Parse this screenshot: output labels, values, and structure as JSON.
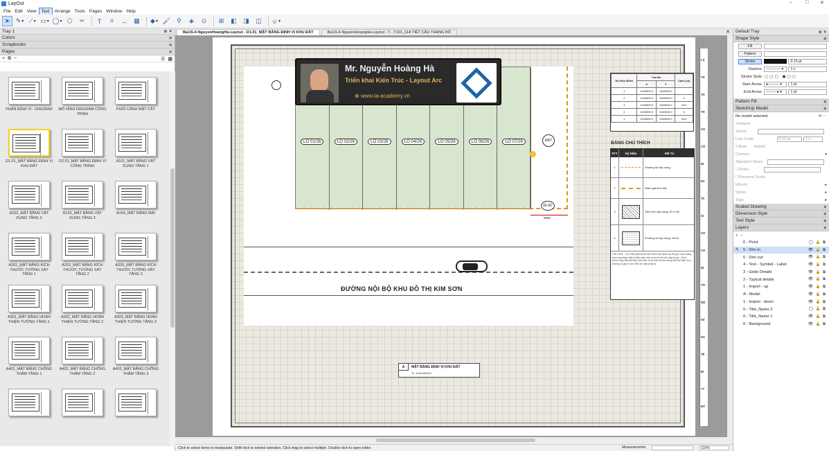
{
  "window": {
    "title": "LayOut",
    "controls": [
      "–",
      "□",
      "✕"
    ]
  },
  "menu": [
    "File",
    "Edit",
    "View",
    "Text",
    "Arrange",
    "Tools",
    "Pages",
    "Window",
    "Help"
  ],
  "menu_active": "Text",
  "toolbar": [
    {
      "icon": "select-icon",
      "glyph": "➤"
    },
    {
      "icon": "pencil-icon",
      "glyph": "✎"
    },
    {
      "icon": "line-icon",
      "glyph": "⟋"
    },
    {
      "icon": "rectangle-icon",
      "glyph": "▭"
    },
    {
      "icon": "circle-icon",
      "glyph": "◯"
    },
    {
      "icon": "polygon-icon",
      "glyph": "⬠"
    },
    {
      "icon": "split-icon",
      "glyph": "✂"
    },
    {
      "icon": "text-icon",
      "glyph": "T"
    },
    {
      "icon": "label-icon",
      "glyph": "⌗"
    },
    {
      "icon": "dimension-icon",
      "glyph": "↔"
    },
    {
      "icon": "table-icon",
      "glyph": "▦"
    },
    {
      "icon": "eraser-icon",
      "glyph": "◆"
    },
    {
      "icon": "style-icon",
      "glyph": "🖌"
    },
    {
      "icon": "sample-icon",
      "glyph": "⚲"
    },
    {
      "icon": "fill-icon",
      "glyph": "◈"
    },
    {
      "icon": "view-icon",
      "glyph": "⊙"
    },
    {
      "icon": "add-page-icon",
      "glyph": "⊞"
    },
    {
      "icon": "prev-page-icon",
      "glyph": "◧"
    },
    {
      "icon": "next-page-icon",
      "glyph": "◨"
    },
    {
      "icon": "presentation-icon",
      "glyph": "◫"
    },
    {
      "icon": "account-icon",
      "glyph": "☺"
    }
  ],
  "tray_left": {
    "title": "Tray 1",
    "sections": [
      "Colors",
      "Scrapbooks",
      "Pages"
    ]
  },
  "pages": [
    {
      "label": "PHÂN ĐỊNH VI - DIAGRAM",
      "selected": false
    },
    {
      "label": "MÔ HÌNH DIAGRAM CÔNG TRÌNH",
      "selected": false
    },
    {
      "label": "PHỐI CẢNH MẶT CẮT",
      "selected": false
    },
    {
      "label": "D1.01_MẶT BẰNG ĐỊNH VỊ KHU ĐẤT",
      "selected": true
    },
    {
      "label": "D2.01_MẶT BẰNG ĐỊNH VỊ CÔNG TRÌNH",
      "selected": false
    },
    {
      "label": "A101_MẶT BẰNG VẬT DỤNG TẦNG 1",
      "selected": false
    },
    {
      "label": "A102_MẶT BẰNG VẬT DỤNG TẦNG 2",
      "selected": false
    },
    {
      "label": "A103_MẶT BẰNG VẬT DỤNG TẦNG 3",
      "selected": false
    },
    {
      "label": "A104_MẶT BẰNG MÁI",
      "selected": false
    },
    {
      "label": "A201_MẶT BẰNG KÍCH THƯỚC TƯỜNG XÂY TẦNG 1",
      "selected": false
    },
    {
      "label": "A202_MẶT BẰNG KÍCH THƯỚC TƯỜNG XÂY TẦNG 2",
      "selected": false
    },
    {
      "label": "A203_MẶT BẰNG KÍCH THƯỚC TƯỜNG XÂY TẦNG 3",
      "selected": false
    },
    {
      "label": "A301_MẶT BẰNG HOÀN THIỆN TƯỜNG TẦNG 1",
      "selected": false
    },
    {
      "label": "A302_MẶT BẰNG HOÀN THIỆN TƯỜNG TẦNG 2",
      "selected": false
    },
    {
      "label": "A303_MẶT BẰNG HOÀN THIỆN TƯỜNG TẦNG 3",
      "selected": false
    },
    {
      "label": "A401_MẶT BẰNG CHỐNG THẤM TẦNG 1",
      "selected": false
    },
    {
      "label": "A402_MẶT BẰNG CHỐNG THẤM TẦNG 2",
      "selected": false
    },
    {
      "label": "A403_MẶT BẰNG CHỐNG THẤM TẦNG 3",
      "selected": false
    },
    {
      "label": "",
      "selected": false
    },
    {
      "label": "",
      "selected": false
    },
    {
      "label": "",
      "selected": false
    }
  ],
  "tabs": [
    {
      "label": "Bai15.4-NguyenHoangHa-Layout - D1.01_MẶT BẰNG ĐỊNH VỊ KHU ĐẤT",
      "active": true
    },
    {
      "label": "Bai15.4-NguyenHoangHa-Layout - T - T101_CHI TIẾT CẦU THANG BỘ",
      "active": false
    }
  ],
  "drawing": {
    "lots": [
      "LÔ 01/26",
      "LÔ 02/26",
      "LÔ 03/26",
      "LÔ 04/26",
      "LÔ 05/26",
      "LÔ 06/26",
      "LÔ 07/26"
    ],
    "road_label": "ĐƯỜNG NỘI BỘ KHU ĐÔ THỊ KIM SƠN",
    "markers": [
      "ĐĐT",
      "ĐLXD"
    ],
    "dim_bottom": "5000",
    "banner": {
      "name": "Mr. Nguyễn Hoàng Hà",
      "role": "Triển khai Kiến Trúc - Layout Arc",
      "web": "www.ta-academy.vn"
    },
    "coord_table": {
      "headers": [
        "Số Hiệu Điểm",
        "Tọa Độ",
        "Cạnh (m)"
      ],
      "subheaders": [
        "X",
        "Y"
      ],
      "rows": [
        [
          "1",
          "1169605.5",
          "1169605.0",
          ""
        ],
        [
          "2",
          "1169605.5",
          "1169605.0",
          "5"
        ],
        [
          "3",
          "1169605.5",
          "1169605.0",
          "18.5"
        ],
        [
          "4",
          "1169605.5",
          "1169605.0",
          "5"
        ],
        [
          "1",
          "1169605.5",
          "1169605.0",
          "18.5"
        ]
      ]
    },
    "legend": {
      "title": "BẢNG CHÚ THÍCH",
      "headers": [
        "STT",
        "Ký Hiệu",
        "Mô Tả"
      ],
      "rows": [
        {
          "n": "1",
          "desc": "Khoảng lùi xây dựng"
        },
        {
          "n": "2",
          "desc": "Ranh giới khu đất"
        },
        {
          "n": "3",
          "desc": "Diện tích xây dựng: 87.5 m2"
        },
        {
          "n": "4",
          "desc": "Khoảng lùi xây dựng: 10m2"
        }
      ],
      "note": "GHI CHÚ: - Khu đất phải được tiến hành xác định tọa độ góc ranh bằng phương pháp thiết bị điều đạc nhà nước trước khi xây dựng. - Kích thước này đất thể hiện trên bản vẽ là kích thước trung thiết kế kiến trúc, không có giá trị xác định về mặt pháp lý."
    },
    "title_block": {
      "letter": "A",
      "title": "MẶT BẰNG ĐỊNH VỊ KHU ĐẤT",
      "scale": "TL: 1mm:200mm"
    },
    "strip_texts": [
      "LẬ",
      "TH",
      "TH",
      "TH",
      "CH",
      "CÔ",
      "ĐỊ",
      "EX",
      "Th",
      "GI",
      "CH",
      "CH",
      "ĐỊ",
      "TÍT",
      "NỘ",
      "KIÍ",
      "HẠ",
      "TÊ",
      "ĐI",
      "TY",
      "BẢ"
    ]
  },
  "tray_right": {
    "title": "Default Tray",
    "shape_style": {
      "title": "Shape Style",
      "fill_label": "Fill",
      "pattern_label": "Pattern",
      "stroke_label": "Stroke",
      "stroke_width": "0.15 pt",
      "dashes_label": "Dashes",
      "dash_scale": "1 x",
      "stroke_style_label": "Stroke Style",
      "start_arrow_label": "Start Arrow",
      "start_size": "1 pt",
      "end_arrow_label": "End Arrow",
      "end_size": "1 pt",
      "stroke_color": "#111111"
    },
    "pattern_fill": "Pattern Fill",
    "sketchup": {
      "title": "SketchUp Model",
      "status": "No model selected",
      "viewport": "Viewport",
      "scene": "Scene",
      "line_scale": "Line Scale",
      "line_scale_val": "0.10 pt",
      "line_scale_x": "1 x",
      "auto": "Auto",
      "hybrid": "Hybrid",
      "camera": "Camera",
      "std_views": "Standard Views",
      "ortho": "Ortho",
      "preserve_scale": "Preserve Scale",
      "effects": "Effects",
      "styles": "Styles",
      "tags": "Tags"
    },
    "collapsed": [
      "Scaled Drawing",
      "Dimension Style",
      "Text Style"
    ],
    "layers_title": "Layers",
    "layers": [
      {
        "name": "6 - Point",
        "selected": false
      },
      {
        "name": "5 - Dim in",
        "selected": true
      },
      {
        "name": "5 - Dim out",
        "selected": false
      },
      {
        "name": "4 - Text - Symbol - Label",
        "selected": false
      },
      {
        "name": "3 - Grids Details",
        "selected": false
      },
      {
        "name": "2 - Typical details",
        "selected": false
      },
      {
        "name": "1 - Import - up",
        "selected": false
      },
      {
        "name": "A - Model",
        "selected": false
      },
      {
        "name": "1 - Import - down",
        "selected": false
      },
      {
        "name": "0 - Title_Name 2",
        "selected": false
      },
      {
        "name": "0 - Title_Name 1",
        "selected": false
      },
      {
        "name": "0 - Background",
        "selected": false
      }
    ]
  },
  "status": {
    "hint": "Click to select items to manipulate. Shift-click to extend selection. Click drag to select multiple. Double-click to open editor.",
    "measurements_label": "Measurements",
    "zoom": "110%"
  },
  "colors": {
    "accent": "#4a86d8",
    "setback": "#e59312",
    "site_green": "#d9e6cf"
  }
}
